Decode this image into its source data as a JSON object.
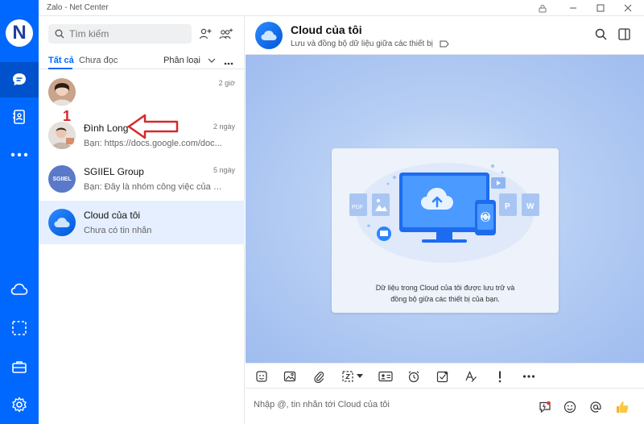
{
  "window": {
    "title": "Zalo - Net Center"
  },
  "rail": {
    "logo_letter": "N"
  },
  "search": {
    "placeholder": "Tìm kiếm"
  },
  "tabs": {
    "all": "Tất cả",
    "unread": "Chưa đọc",
    "filter": "Phân loại"
  },
  "conversations": [
    {
      "name": "",
      "preview": "",
      "time": "2 giờ"
    },
    {
      "name": "Đình Long",
      "preview": "Bạn: https://docs.google.com/doc...",
      "time": "2 ngày"
    },
    {
      "name": "SGIIEL Group",
      "preview": "Bạn: Đây là nhóm công việc của S...",
      "time": "5 ngày",
      "avatar_text": "SGIIEL"
    },
    {
      "name": "Cloud của tôi",
      "preview": "Chưa có tin nhắn",
      "time": ""
    }
  ],
  "annotation": {
    "number": "1"
  },
  "chat": {
    "title": "Cloud của tôi",
    "subtitle": "Lưu và đồng bộ dữ liệu giữa các thiết bị",
    "card_text_line1": "Dữ liệu trong Cloud của tôi được lưu trữ và",
    "card_text_line2": "đồng bộ giữa các thiết bị của bạn.",
    "file_pdf": "PDF",
    "file_p": "P",
    "file_w": "W"
  },
  "composer": {
    "placeholder": "Nhập @, tin nhắn tới Cloud của tôi"
  },
  "colors": {
    "brand": "#0068ff",
    "selected_row": "#e5efff",
    "annotation": "#d42a2a"
  }
}
